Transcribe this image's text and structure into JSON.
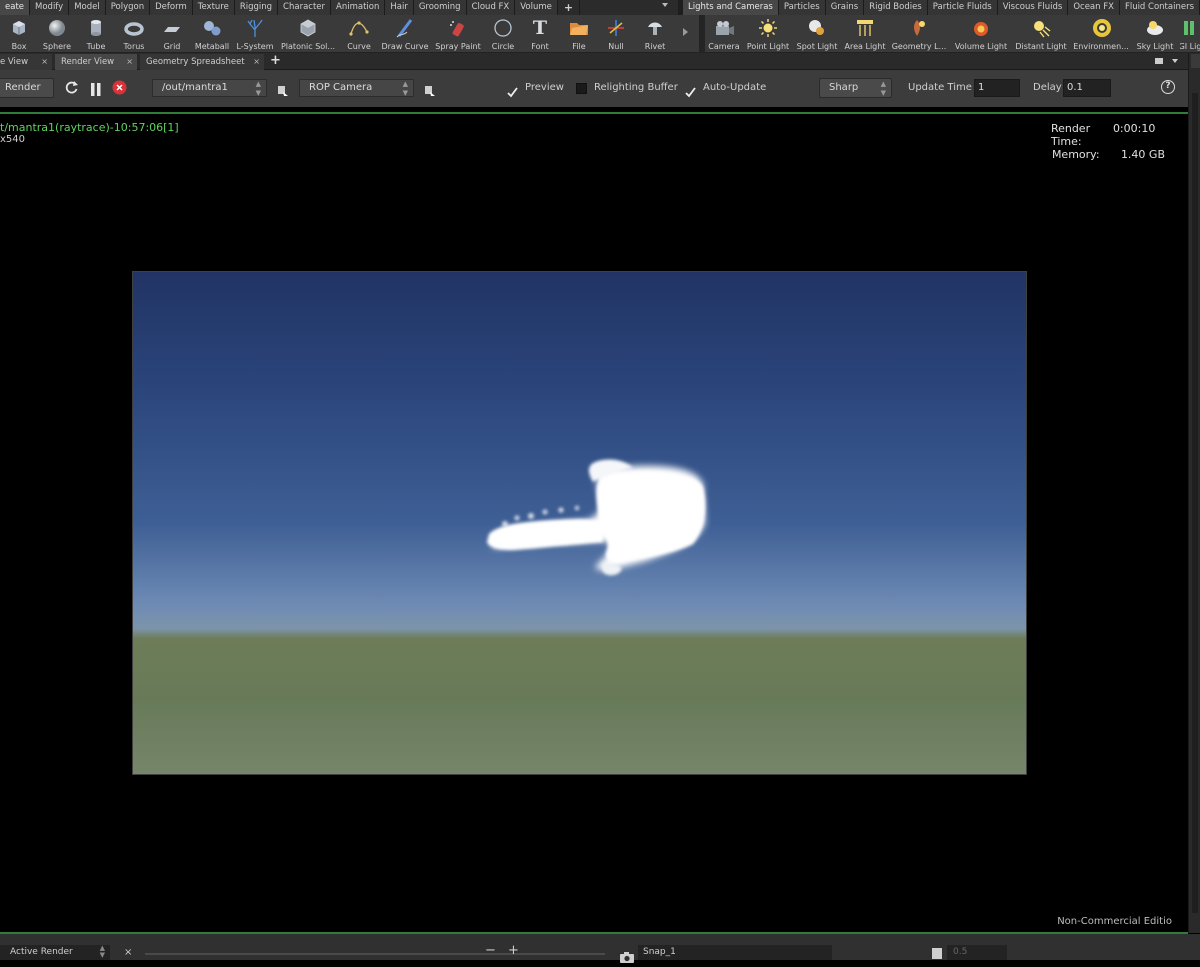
{
  "shelf_tabs_left": [
    "eate",
    "Modify",
    "Model",
    "Polygon",
    "Deform",
    "Texture",
    "Rigging",
    "Character",
    "Animation",
    "Hair",
    "Grooming",
    "Cloud FX",
    "Volume",
    "+"
  ],
  "shelf_tabs_right": [
    "Lights and Cameras",
    "Particles",
    "Grains",
    "Rigid Bodies",
    "Particle Fluids",
    "Viscous Fluids",
    "Ocean FX",
    "Fluid Containers"
  ],
  "tools_left": [
    "Box",
    "Sphere",
    "Tube",
    "Torus",
    "Grid",
    "Metaball",
    "L-System",
    "Platonic Sol...",
    "Curve",
    "Draw Curve",
    "Spray Paint",
    "Circle",
    "Font",
    "File",
    "Null",
    "Rivet"
  ],
  "tools_right": [
    "Camera",
    "Point Light",
    "Spot Light",
    "Area Light",
    "Geometry L...",
    "Volume Light",
    "Distant Light",
    "Environmen...",
    "Sky Light",
    "GI Lig"
  ],
  "pane_tabs": {
    "tab1": "e View",
    "tab2": "Render View",
    "tab3": "Geometry Spreadsheet",
    "close": "×",
    "add": "+"
  },
  "toolbar": {
    "render_label": "Render",
    "rop_path": "/out/mantra1",
    "camera": "ROP Camera",
    "preview": "Preview",
    "relighting": "Relighting Buffer",
    "auto_update": "Auto-Update",
    "sharp": "Sharp",
    "update_time_label": "Update Time",
    "update_time_value": "1",
    "delay_label": "Delay",
    "delay_value": "0.1",
    "help": "?"
  },
  "viewport": {
    "title": "t/mantra1(raytrace)-10:57:06[1]",
    "resolution": "x540",
    "render_time_label": "Render Time:",
    "render_time_value": "0:00:10",
    "memory_label": "Memory:",
    "memory_value": "1.40 GB",
    "edition": "Non-Commercial Editio"
  },
  "bottom": {
    "active_render": "Active Render",
    "close": "×",
    "minus": "−",
    "plus": "+",
    "snap": "Snap_1",
    "snap_value": "0.5"
  },
  "colors": {
    "accent_green": "#2f7d38",
    "title_green": "#5fd35f"
  }
}
